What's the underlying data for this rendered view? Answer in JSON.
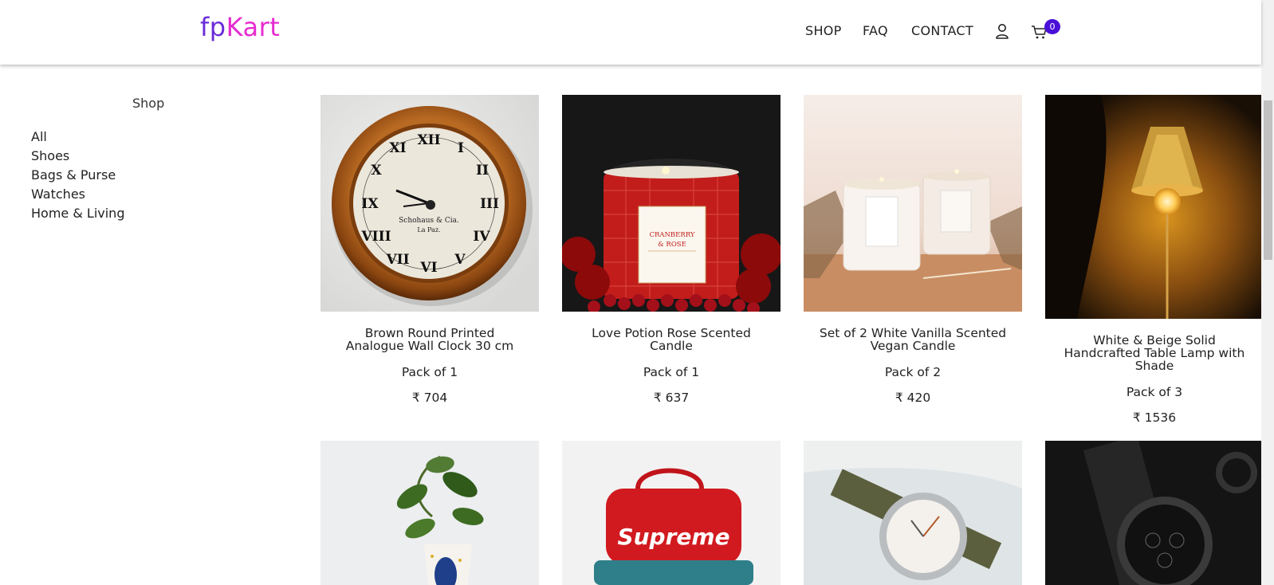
{
  "header": {
    "logo_part1": "fp",
    "logo_part2": "Kart",
    "nav": {
      "shop": "SHOP",
      "faq": "FAQ",
      "contact": "CONTACT"
    },
    "cart_count": "0"
  },
  "sidebar": {
    "title": "Shop",
    "items": [
      {
        "label": "All"
      },
      {
        "label": "Shoes"
      },
      {
        "label": "Bags & Purse"
      },
      {
        "label": "Watches"
      },
      {
        "label": "Home & Living"
      }
    ]
  },
  "products": [
    {
      "name": "Brown Round Printed Analogue Wall Clock 30 cm",
      "pack": "Pack of 1",
      "price": "₹ 704"
    },
    {
      "name": "Love Potion Rose Scented Candle",
      "pack": "Pack of 1",
      "price": "₹ 637"
    },
    {
      "name": "Set of 2 White Vanilla Scented Vegan Candle",
      "pack": "Pack of 2",
      "price": "₹ 420"
    },
    {
      "name": "White & Beige Solid Handcrafted Table Lamp with Shade",
      "pack": "Pack of 3",
      "price": "₹ 1536"
    }
  ],
  "image_text": {
    "clock_maker": "Schohaus & Cia.",
    "clock_city": "La Paz.",
    "candle_label_1": "CRANBERRY",
    "candle_label_2": "& ROSE",
    "bag_brand": "Supreme"
  },
  "colors": {
    "logo_purple": "#6a2bd9",
    "logo_pink": "#e62bd0",
    "badge": "#4a10d8"
  }
}
